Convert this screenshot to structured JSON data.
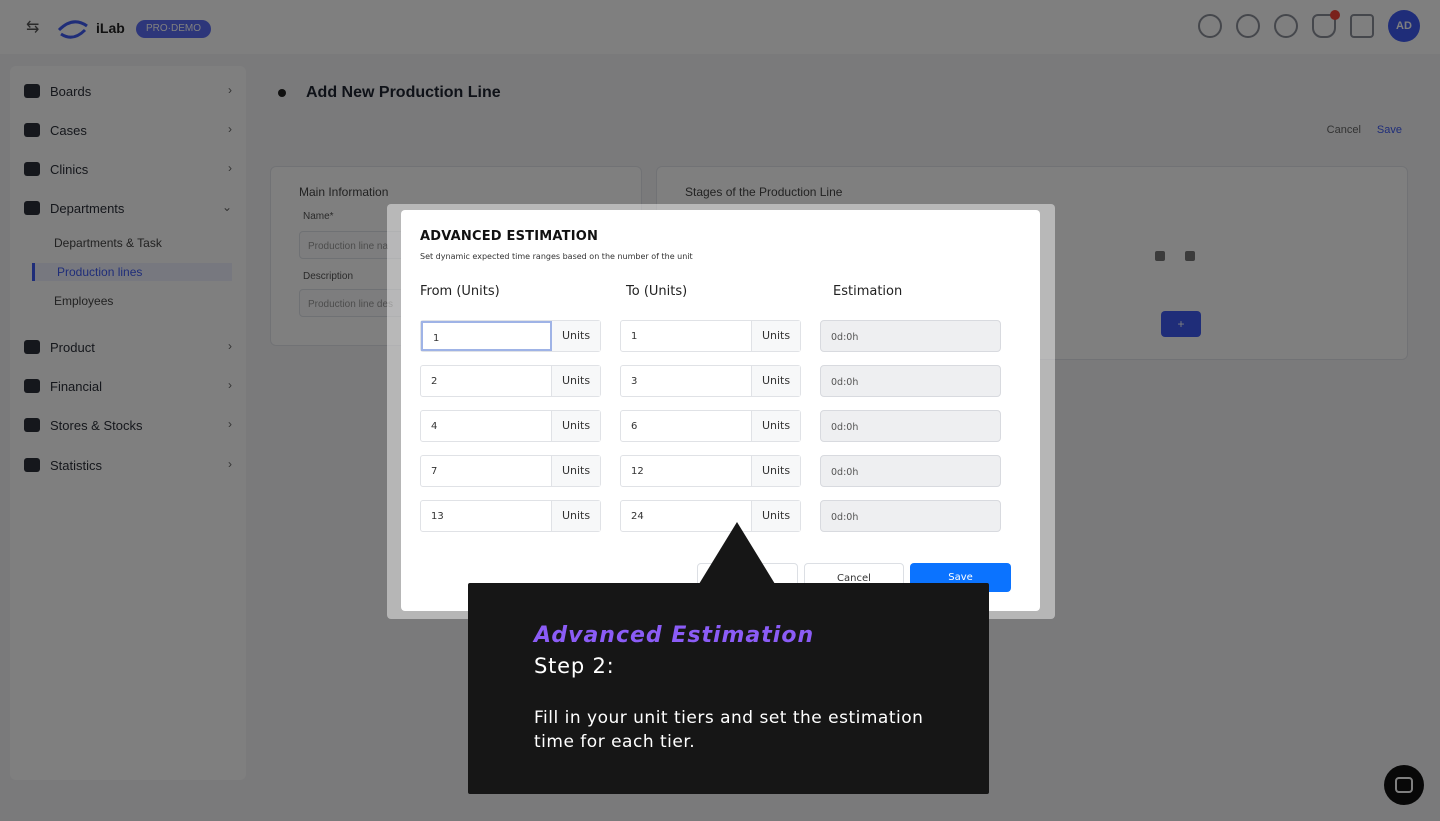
{
  "topbar": {
    "brand": "iLab",
    "env_badge": "PRO·DEMO",
    "avatar_initials": "AD"
  },
  "sidebar": {
    "items": [
      {
        "label": "Boards"
      },
      {
        "label": "Cases"
      },
      {
        "label": "Clinics"
      },
      {
        "label": "Departments"
      },
      {
        "label": "Product"
      },
      {
        "label": "Financial"
      },
      {
        "label": "Stores & Stocks"
      },
      {
        "label": "Statistics"
      }
    ],
    "departments_sub": [
      "Departments & Task",
      "Production lines",
      "Employees"
    ]
  },
  "page": {
    "title": "Add New Production Line",
    "cancel": "Cancel",
    "save": "Save",
    "main_info_title": "Main Information",
    "name_label": "Name*",
    "name_placeholder": "Production line na",
    "description_label": "Description",
    "description_placeholder": "Production line des",
    "stages_title": "Stages of the Production Line",
    "add_button": "+"
  },
  "modal": {
    "title": "ADVANCED ESTIMATION",
    "subtitle": "Set dynamic expected time ranges based on the number of the unit",
    "col_from": "From (Units)",
    "col_to": "To (Units)",
    "col_estimation": "Estimation",
    "unit_label": "Units",
    "rows": [
      {
        "from": "1",
        "to": "1",
        "estimation": "0d:0h"
      },
      {
        "from": "2",
        "to": "3",
        "estimation": "0d:0h"
      },
      {
        "from": "4",
        "to": "6",
        "estimation": "0d:0h"
      },
      {
        "from": "7",
        "to": "12",
        "estimation": "0d:0h"
      },
      {
        "from": "13",
        "to": "24",
        "estimation": "0d:0h"
      }
    ],
    "reset": "Reset",
    "cancel": "Cancel",
    "save": "Save"
  },
  "tooltip": {
    "title": "Advanced Estimation",
    "step": "Step 2:",
    "body": "Fill in your unit tiers and set the estimation time for each tier."
  }
}
